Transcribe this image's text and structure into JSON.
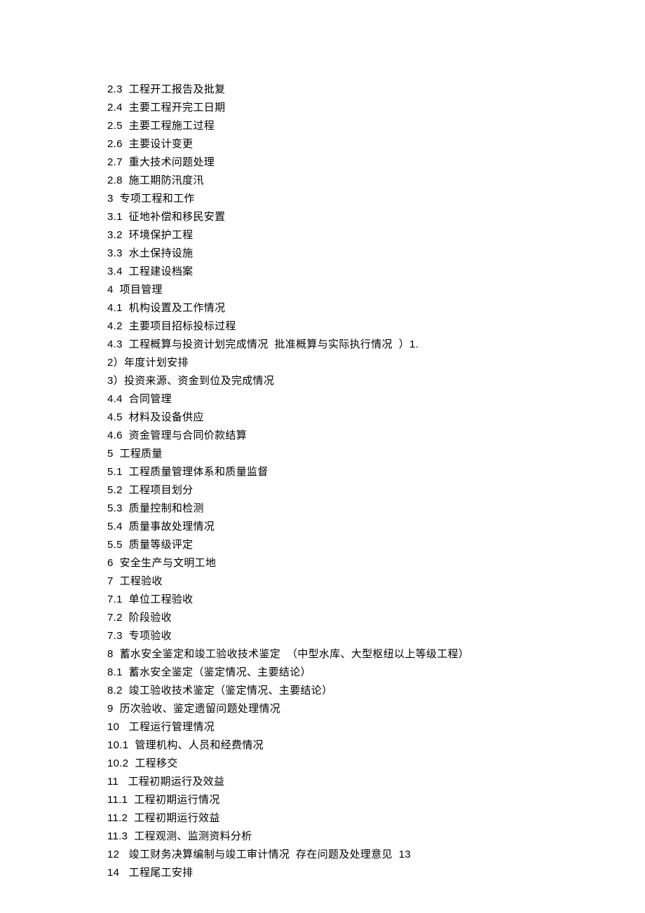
{
  "lines": [
    "2.3  工程开工报告及批复",
    "2.4  主要工程开完工日期",
    "2.5  主要工程施工过程",
    "2.6  主要设计变更",
    "2.7  重大技术问题处理",
    "2.8  施工期防汛度汛",
    "3  专项工程和工作",
    "3.1  征地补偿和移民安置",
    "3.2  环境保护工程",
    "3.3  水土保持设施",
    "3.4  工程建设档案",
    "4  项目管理",
    "4.1  机构设置及工作情况",
    "4.2  主要项目招标投标过程",
    "4.3  工程概算与投资计划完成情况  批准概算与实际执行情况  ）1.",
    "2）年度计划安排",
    "3）投资来源、资金到位及完成情况",
    "4.4  合同管理",
    "4.5  材料及设备供应",
    "4.6  资金管理与合同价款结算",
    "5  工程质量",
    "5.1  工程质量管理体系和质量监督",
    "5.2  工程项目划分",
    "5.3  质量控制和检测",
    "5.4  质量事故处理情况",
    "5.5  质量等级评定",
    "6  安全生产与文明工地",
    "7  工程验收",
    "7.1  单位工程验收",
    "7.2  阶段验收",
    "7.3  专项验收",
    "8  蓄水安全鉴定和竣工验收技术鉴定  （中型水库、大型枢纽以上等级工程）",
    "8.1  蓄水安全鉴定（鉴定情况、主要结论）",
    "8.2  竣工验收技术鉴定（鉴定情况、主要结论）",
    "9  历次验收、鉴定遗留问题处理情况",
    "10   工程运行管理情况",
    "10.1  管理机构、人员和经费情况",
    "10.2  工程移交",
    "11   工程初期运行及效益",
    "11.1  工程初期运行情况",
    "11.2  工程初期运行效益",
    "11.3  工程观测、监测资料分析",
    "12   竣工财务决算编制与竣工审计情况  存在问题及处理意见  13",
    "14   工程尾工安排"
  ]
}
